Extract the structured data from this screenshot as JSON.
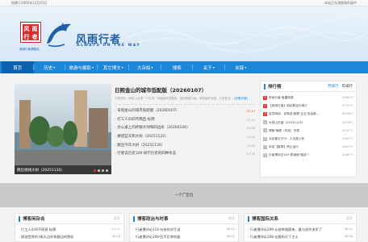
{
  "topbar": {
    "left": "创建于2001年12月31日",
    "right": "本站正在改版和升级中"
  },
  "brand": {
    "seal_chars": [
      "风",
      "雨",
      "行",
      "者"
    ],
    "title": "风雨行者",
    "subtitle": "ALWAYS ON THE WAY",
    "slogan": "风雨行者博客站"
  },
  "nav": [
    {
      "label": "首页",
      "dropdown": false
    },
    {
      "label": "历史",
      "dropdown": true
    },
    {
      "label": "旅游与摄影",
      "dropdown": true
    },
    {
      "label": "其它博文",
      "dropdown": true
    },
    {
      "label": "大杂烩",
      "dropdown": true
    },
    {
      "label": "搜索",
      "dropdown": false
    },
    {
      "label": "关于",
      "dropdown": true
    },
    {
      "label": "友链",
      "dropdown": true
    }
  ],
  "slider": {
    "caption": "跳出视线大树（20251130）",
    "dot_count": 4,
    "active_dot": 0
  },
  "headline": {
    "title": "日照金山的城市低配版（20260107）",
    "summary": "不知何时，网络上出现一个名词，叫做城市低配版，指的是缩小版、简化版的名城，乃至各式…",
    "more": "[查看详情]"
  },
  "news": [
    {
      "title": "日照金山的城市低配版（20260107）",
      "date": "01-17",
      "highlight": true
    },
    {
      "title": "打工人の四不两直 标牌",
      "date": "12-11",
      "highlight": false
    },
    {
      "title": "办公桌上的绊脚大师和四边形（20260106）",
      "date": "01-08",
      "highlight": false
    },
    {
      "title": "做望蓝天和大树（20251122）",
      "date": "12-04",
      "highlight": false
    },
    {
      "title": "跳出今年大树（20251130）",
      "date": "12-04",
      "highlight": false
    },
    {
      "title": "行者说历史109·研学历史的四种形态",
      "date": "11-16",
      "highlight": false
    }
  ],
  "ranking": {
    "title": "排行榜",
    "tabs": [
      "月排行",
      "年排行"
    ],
    "active_tab": 0,
    "items": [
      {
        "title": "风雨行者·鱼翼简易",
        "value": "32481℃"
      },
      {
        "title": "【风雨行者】网站和站长简介",
        "value": "42727℃"
      },
      {
        "title": "会员网站：自驾游·越野·企业·协会推…",
        "value": "36198℃"
      },
      {
        "title": "大别山在望（20151115）",
        "value": "21576℃"
      },
      {
        "title": "博客·随便（内站）列表",
        "value": "21157℃"
      },
      {
        "title": "北京夏日方行，人无真少年",
        "value": "13447℃"
      },
      {
        "title": "本站【推荐】停止运行",
        "value": "13451℃"
      },
      {
        "title": "行者博评论109·表演面\"威武\"！",
        "value": "12487℃"
      }
    ]
  },
  "ad": {
    "label": "一个广告位"
  },
  "columns": [
    {
      "title": "博客闲杂合",
      "more": "更多",
      "items": [
        {
          "title": "打工人の四不两直 标牌",
          "date": "12-11"
        },
        {
          "title": "周游世界的3乘天边外和路边的野花",
          "date": "08-18"
        }
      ]
    },
    {
      "title": "博客政治与时事",
      "more": "更多",
      "items": [
        {
          "title": "行者博评论214·在有的学生说",
          "date": "08-22"
        },
        {
          "title": "行者博评论209·民不忍孝的路",
          "date": "08-01"
        }
      ]
    },
    {
      "title": "博客国际关系",
      "more": "更多",
      "items": [
        {
          "title": "行者博评论209·从各种观察来，量与质齐进军了",
          "date": "08-22"
        },
        {
          "title": "行者博评论208·论路的天下主义",
          "date": "08-06"
        }
      ]
    }
  ],
  "colors": {
    "nav": "#1e86d6",
    "nav_active": "#0b62ad",
    "accent_red": "#e33",
    "brand_blue": "#1d5fa8"
  }
}
